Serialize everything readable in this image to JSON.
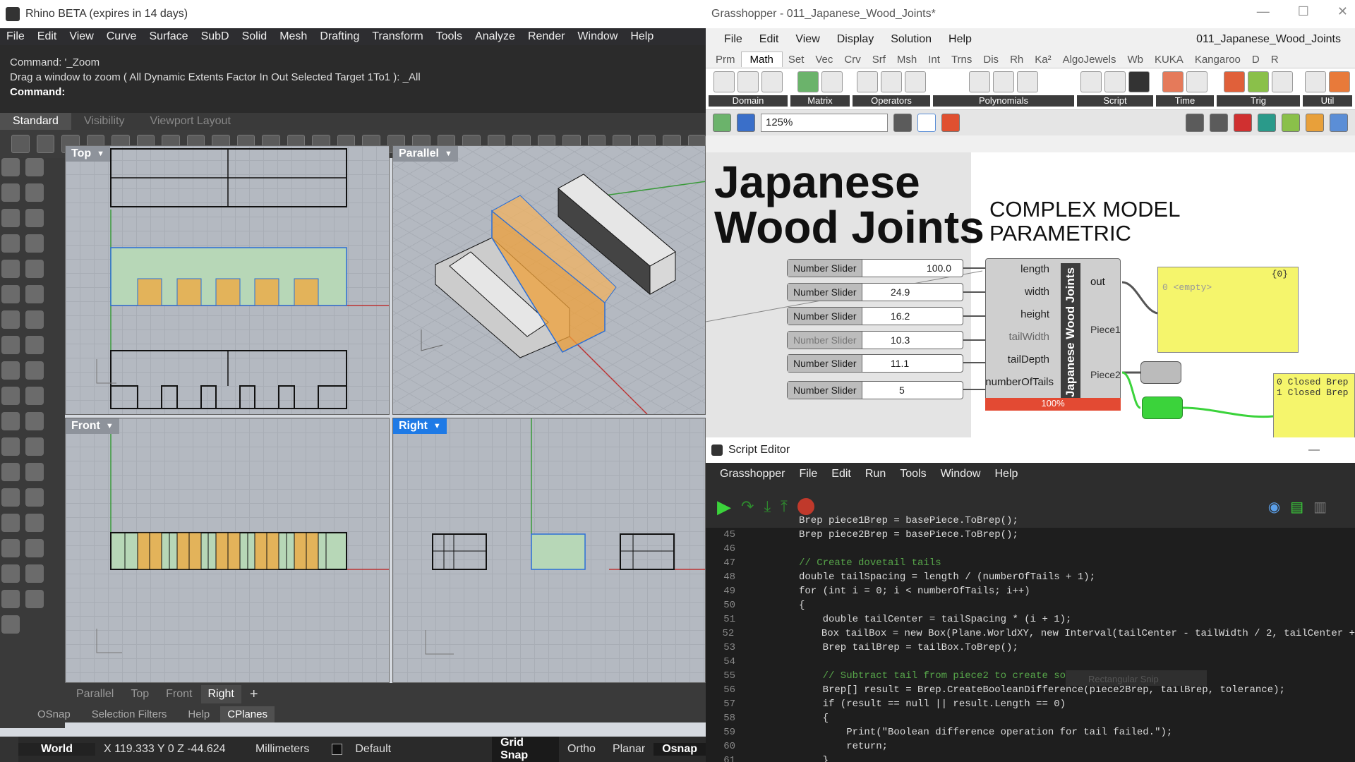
{
  "rhino": {
    "title": "Rhino BETA (expires in 14 days)",
    "menu": [
      "File",
      "Edit",
      "View",
      "Curve",
      "Surface",
      "SubD",
      "Solid",
      "Mesh",
      "Drafting",
      "Transform",
      "Tools",
      "Analyze",
      "Render",
      "Window",
      "Help"
    ],
    "command_history": [
      "Command: '_Zoom",
      "Drag a window to zoom ( All  Dynamic  Extents  Factor  In  Out  Selected  Target  1To1 ): _All"
    ],
    "command_prompt": "Command:",
    "toolbar_tabs": [
      "Standard",
      "Visibility",
      "Viewport Layout"
    ],
    "viewports": {
      "top": "Top",
      "parallel": "Parallel",
      "front": "Front",
      "right": "Right"
    },
    "viewport_tabs": [
      "Parallel",
      "Top",
      "Front",
      "Right",
      "+"
    ],
    "bottom_tabs": [
      "OSnap",
      "Selection Filters",
      "Help",
      "CPlanes"
    ],
    "status": {
      "cplane": "World",
      "coords": "X 119.333 Y 0 Z -44.624",
      "units": "Millimeters",
      "layer": "Default",
      "grid_snap": "Grid Snap",
      "ortho": "Ortho",
      "planar": "Planar",
      "osnap": "Osnap"
    }
  },
  "grasshopper": {
    "title": "Grasshopper - 011_Japanese_Wood_Joints*",
    "menu": [
      "File",
      "Edit",
      "View",
      "Display",
      "Solution",
      "Help"
    ],
    "doc_name": "011_Japanese_Wood_Joints",
    "tabs": [
      "Prm",
      "Math",
      "Set",
      "Vec",
      "Crv",
      "Srf",
      "Msh",
      "Int",
      "Trns",
      "Dis",
      "Rh",
      "Ka²",
      "AlgoJewels",
      "Wb",
      "KUKA",
      "Kangaroo",
      "D",
      "R"
    ],
    "ribbon_groups": [
      "Domain",
      "Matrix",
      "Operators",
      "Polynomials",
      "Script",
      "Time",
      "Trig",
      "Util"
    ],
    "zoom": "125%",
    "canvas": {
      "title_lines": [
        "Japanese",
        "Wood Joints"
      ],
      "subtitle_lines": [
        "COMPLEX MODEL",
        "PARAMETRIC"
      ],
      "sliders": [
        {
          "label": "Number Slider",
          "value": "100.0"
        },
        {
          "label": "Number Slider",
          "value": "24.9"
        },
        {
          "label": "Number Slider",
          "value": "16.2"
        },
        {
          "label": "Number Slider",
          "value": "10.3"
        },
        {
          "label": "Number Slider",
          "value": "11.1"
        },
        {
          "label": "Number Slider",
          "value": "5"
        }
      ],
      "component": {
        "name": "Japanese Wood Joints",
        "inputs": [
          "length",
          "width",
          "height",
          "tailWidth",
          "tailDepth",
          "numberOfTails"
        ],
        "outputs": [
          "out",
          "Piece1",
          "Piece2"
        ],
        "progress": "100%"
      },
      "panel": {
        "header": "{0}",
        "content": "0 <empty>"
      },
      "panel2": {
        "lines": [
          "0 Closed Brep",
          "1 Closed Brep"
        ]
      }
    }
  },
  "script_editor": {
    "title": "Script Editor",
    "menu": [
      "Grasshopper",
      "File",
      "Edit",
      "Run",
      "Tools",
      "Window",
      "Help"
    ],
    "tooltip": "Rectangular Snip",
    "lines": [
      {
        "n": "",
        "t": "Brep piece1Brep = basePiece.ToBrep();"
      },
      {
        "n": "45",
        "t": "Brep piece2Brep = basePiece.ToBrep();"
      },
      {
        "n": "46",
        "t": ""
      },
      {
        "n": "47",
        "t": "// Create dovetail tails"
      },
      {
        "n": "48",
        "t": "double tailSpacing = length / (numberOfTails + 1);"
      },
      {
        "n": "49",
        "t": "for (int i = 0; i < numberOfTails; i++)"
      },
      {
        "n": "50",
        "t": "{"
      },
      {
        "n": "51",
        "t": "    double tailCenter = tailSpacing * (i + 1);"
      },
      {
        "n": "52",
        "t": "    Box tailBox = new Box(Plane.WorldXY, new Interval(tailCenter - tailWidth / 2, tailCenter +"
      },
      {
        "n": "53",
        "t": "    Brep tailBrep = tailBox.ToBrep();"
      },
      {
        "n": "54",
        "t": ""
      },
      {
        "n": "55",
        "t": "    // Subtract tail from piece2 to create socket"
      },
      {
        "n": "56",
        "t": "    Brep[] result = Brep.CreateBooleanDifference(piece2Brep, tailBrep, tolerance);"
      },
      {
        "n": "57",
        "t": "    if (result == null || result.Length == 0)"
      },
      {
        "n": "58",
        "t": "    {"
      },
      {
        "n": "59",
        "t": "        Print(\"Boolean difference operation for tail failed.\");"
      },
      {
        "n": "60",
        "t": "        return;"
      },
      {
        "n": "61",
        "t": "    }"
      }
    ]
  }
}
